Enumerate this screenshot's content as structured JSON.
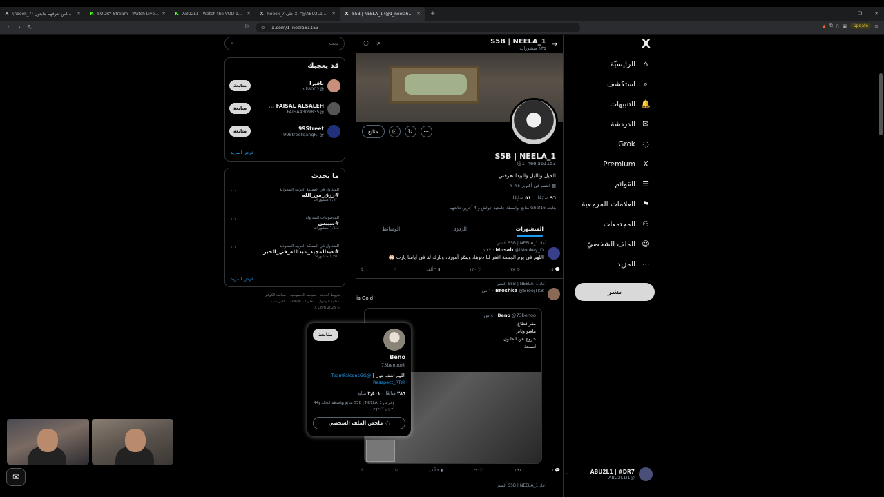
{
  "browser": {
    "tabs": [
      {
        "icon": "X",
        "title": "(hoook_7) أشخاص تعرفهم يتابعون / X",
        "active": false,
        "kick": false
      },
      {
        "icon": "K",
        "title": "SODRY Stream - Watch Live on Kick",
        "active": false,
        "kick": true
      },
      {
        "icon": "K",
        "title": "ABU2L1 - Watch the VOD on Kick",
        "active": false,
        "kick": true
      },
      {
        "icon": "X",
        "title": "hoook_7 على X: \"@ABU2L1 ي على تحتل",
        "active": false,
        "kick": false
      },
      {
        "icon": "X",
        "title": "S5B | NEELA_1 (@1_neela61153",
        "active": true,
        "kick": false
      }
    ],
    "new_tab": "+",
    "url": "x.com/1_neela61153",
    "update_label": "Update"
  },
  "nav": {
    "logo": "X",
    "items": [
      {
        "label": "الرئيسيّة",
        "icon": "⌂"
      },
      {
        "label": "استكشف",
        "icon": "⌕"
      },
      {
        "label": "التنبيهات",
        "icon": "🔔"
      },
      {
        "label": "الدردشة",
        "icon": "✉"
      },
      {
        "label": "Grok",
        "icon": "◌"
      },
      {
        "label": "Premium",
        "icon": "X"
      },
      {
        "label": "القوائم",
        "icon": "☰"
      },
      {
        "label": "العلامات المرجعية",
        "icon": "⚑"
      },
      {
        "label": "المجتمعات",
        "icon": "⚇"
      },
      {
        "label": "الملف الشخصيّ",
        "icon": "☺"
      },
      {
        "label": "المزيد",
        "icon": "⋯"
      }
    ],
    "post_button": "نشر",
    "account": {
      "name": "ABU2L1 | #DR7",
      "handle": "@ABU2L1l1"
    }
  },
  "profile": {
    "header_name": "S5B | NEELA_1",
    "header_posts": "١٣٥ منشورات",
    "name": "S5B | NEELA_1",
    "handle": "@1_neela61153",
    "bio": "الخيل والليل والبيدا تعرفني",
    "joined": "انضم في أكتوبر ٢٠٢٥",
    "following_count": "٩٦",
    "following_label": "متابَعًا",
    "followers_count": "٥١",
    "followers_label": "متابِعًا",
    "followed_by": "يتابعه Ghaf16 متابع بواسطة جامعية جواش و 4 آخرين تتابعهم",
    "follow_button": "متابَع",
    "tabs": [
      "المنشورات",
      "الردود",
      "الوسائط"
    ]
  },
  "posts": [
    {
      "repost": "أعاد S5B | NEELA_1 النشر",
      "author": "Musab",
      "handle": "@iMonkey_D · ٢٧ د",
      "text": "اللهم في يوم الجمعة اغفر لنا ذنوبنا، ويسّر أمورنا، وبارك لنا في أيامنا يارب 🤲🏻",
      "actions": {
        "reply": "١٥",
        "repost": "٢٨",
        "like": "١٢٠",
        "views": "٦ آلف"
      }
    },
    {
      "repost": "أعاد S5B | NEELA_1 النشر",
      "author": "Broshka",
      "handle": "@BroojTK8 · ١ س",
      "text": "Old is Gold",
      "quote": {
        "author": "Beno",
        "handle": "@73benoo · ٤ س",
        "lines": [
          "مقر قطاع",
          "مافيو وثابر",
          "خروج عن القانون",
          "اسلحة",
          "..."
        ]
      },
      "actions": {
        "reply": "٧",
        "repost": "٦",
        "like": "٣٢",
        "views": "٢ آلف"
      }
    },
    {
      "repost": "أعاد S5B | NEELA_1 النشر"
    }
  ],
  "sidebar": {
    "search_placeholder": "بحث",
    "who_title": "قد يعجبك",
    "who": [
      {
        "name": "بافيرا",
        "handle": "@bili8002",
        "button": "متابعة",
        "color": "#c98f7b"
      },
      {
        "name": "FAISAL ALSALEH ...",
        "handle": "@FAISA4309835",
        "button": "متابعة",
        "color": "#555555"
      },
      {
        "name": "99Street",
        "handle": "@99StreetgangRT",
        "button": "متابعة",
        "color": "#20307a"
      }
    ],
    "show_more": "عرض المزيد",
    "trends_title": "ما يحدث",
    "trends": [
      {
        "context": "المتداول في المملكة العربية السعودية",
        "name": "#رزق_من_الله",
        "count": "٢,٩٣٠ منشورات"
      },
      {
        "context": "الموضوعات المتداولة",
        "name": "#سبيس",
        "count": "٦,٦٤٤ منشورات"
      },
      {
        "context": "المتداول في المملكة العربية السعودية",
        "name": "#عبدالمجيد_عبدالله_في_الخبر",
        "count": "١,٢٥٠ منشورات"
      }
    ],
    "show_more2": "عرض المزيد",
    "footer": [
      "شروط الخدمة",
      "سياسة الخصوصية",
      "سياسة الكوكيز",
      "إمكانية الوصول",
      "معلومات الإعلانات",
      "المزيد ···",
      "© 2025 X Corp."
    ]
  },
  "hovercard": {
    "name": "Beno",
    "handle": "@73benoo",
    "follow": "متابعة",
    "bio": "اللهم اشف بتول |",
    "links": [
      "@TeamFalconsGG",
      "@Resspect_RT"
    ],
    "following": "٢٨٦",
    "following_label": "متابَعًا",
    "followers": "٣,٤٠١",
    "followers_label": "متابِع",
    "mutual": "وفارس S5B | NEELA_1 متابَع بواسطة الخالد و44 آخرين تتابعهم",
    "profile_button": "ملخص الملف الشخصي"
  }
}
